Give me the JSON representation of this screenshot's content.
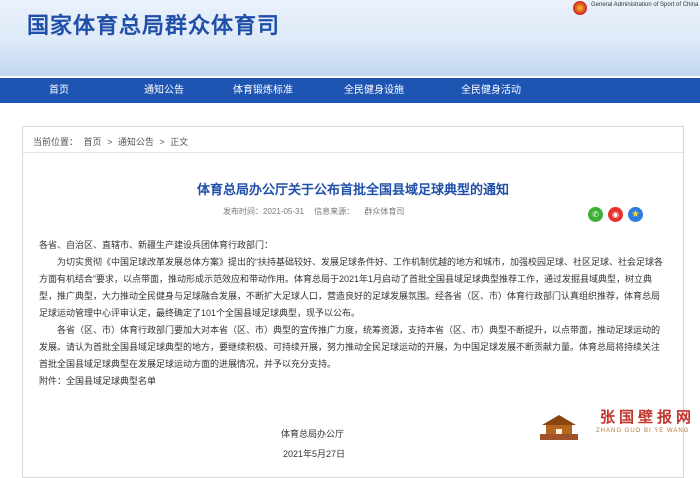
{
  "header": {
    "site_title": "国家体育总局群众体育司",
    "en_title": "General Administration of Sport of China"
  },
  "nav": {
    "items": [
      {
        "label": "首页"
      },
      {
        "label": "通知公告"
      },
      {
        "label": "体育锻炼标准"
      },
      {
        "label": "全民健身设施"
      },
      {
        "label": "全民健身活动"
      }
    ]
  },
  "breadcrumb": {
    "prefix": "当前位置：",
    "items": [
      "首页",
      ">",
      "通知公告",
      ">",
      "正文"
    ]
  },
  "article": {
    "title": "体育总局办公厅关于公布首批全国县域足球典型的通知",
    "meta": {
      "date": "发布时间：2021-05-31",
      "source": "信息来源：",
      "author": "群众体育司"
    },
    "share": {
      "wechat_glyph": "✆",
      "weibo_glyph": "◉",
      "qzone_glyph": "★"
    },
    "salutation": "各省、自治区、直辖市、新疆生产建设兵团体育行政部门：",
    "paragraph1": "为切实贯彻《中国足球改革发展总体方案》提出的“扶持基础较好、发展足球条件好、工作机制优越的地方和城市，加强校园足球、社区足球、社会足球各方面有机结合”要求，以点带面，推动形成示范效应和带动作用。体育总局于2021年1月启动了首批全国县域足球典型推荐工作，通过发掘县域典型，树立典型，推广典型，大力推动全民健身与足球融合发展，不断扩大足球人口，营造良好的足球发展氛围。经各省（区、市）体育行政部门认真组织推荐，体育总局足球运动管理中心评审认定，最终确定了101个全国县域足球典型，现予以公布。",
    "paragraph2": "各省（区、市）体育行政部门要加大对本省（区、市）典型的宣传推广力度，统筹资源，支持本省（区、市）典型不断提升，以点带面，推动足球运动的发展。请认为首批全国县域足球典型的地方，要继续积极、可持续开展，努力推动全民足球运动的开展，为中国足球发展不断贡献力量。体育总局将持续关注首批全国县域足球典型在发展足球运动方面的进展情况，并予以充分支持。",
    "attachment": "附件：全国县域足球典型名单",
    "signature_org": "体育总局办公厅",
    "signature_date": "2021年5月27日"
  },
  "watermark": {
    "text": "张国壁报网",
    "pinyin": "ZHANG GUO BI YE WANG"
  },
  "colors": {
    "brand_blue": "#1f4fa8",
    "nav_blue": "#1e55b3",
    "watermark_red": "#c0362c"
  }
}
